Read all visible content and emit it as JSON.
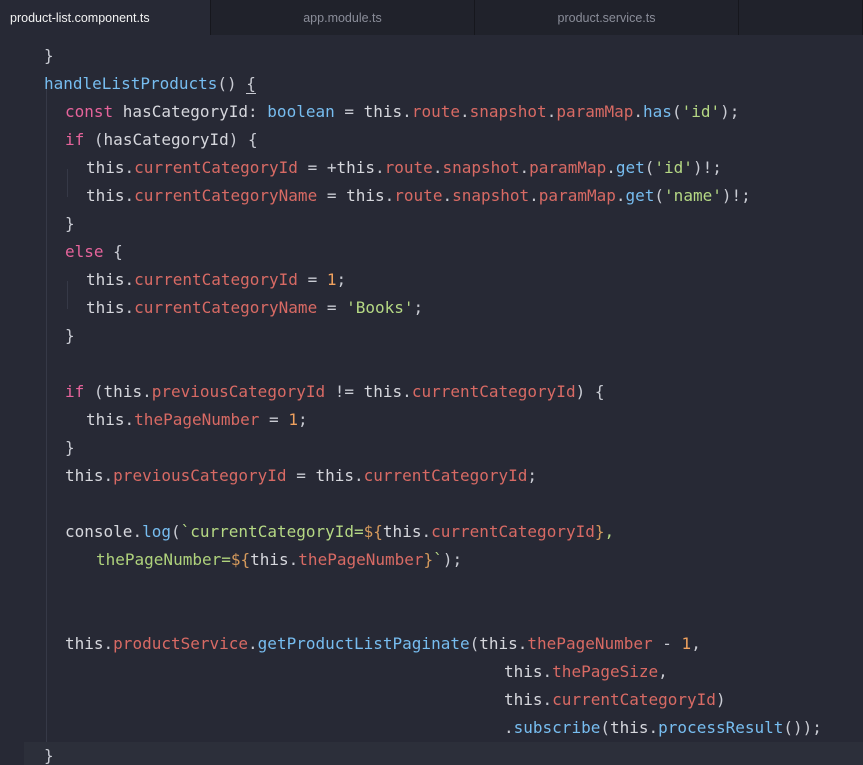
{
  "tabs": [
    {
      "label": "product-list.component.ts",
      "active": true
    },
    {
      "label": "app.module.ts",
      "active": false
    },
    {
      "label": "product.service.ts",
      "active": false
    }
  ],
  "code": {
    "lines": [
      {
        "indent": 44,
        "tokens": [
          {
            "c": "o",
            "v": "}"
          }
        ]
      },
      {
        "indent": 44,
        "tokens": [
          {
            "c": "f",
            "v": "handleListProducts"
          },
          {
            "c": "o",
            "v": "() "
          },
          {
            "c": "o ul",
            "v": "{"
          }
        ]
      },
      {
        "indent": 65,
        "tokens": [
          {
            "c": "k",
            "v": "const "
          },
          {
            "c": "t",
            "v": "hasCategoryId"
          },
          {
            "c": "o",
            "v": ": "
          },
          {
            "c": "f",
            "v": "boolean"
          },
          {
            "c": "o",
            "v": " = "
          },
          {
            "c": "t",
            "v": "this"
          },
          {
            "c": "o",
            "v": "."
          },
          {
            "c": "p",
            "v": "route"
          },
          {
            "c": "o",
            "v": "."
          },
          {
            "c": "p",
            "v": "snapshot"
          },
          {
            "c": "o",
            "v": "."
          },
          {
            "c": "p",
            "v": "paramMap"
          },
          {
            "c": "o",
            "v": "."
          },
          {
            "c": "f",
            "v": "has"
          },
          {
            "c": "o",
            "v": "("
          },
          {
            "c": "s",
            "v": "'id'"
          },
          {
            "c": "o",
            "v": ");"
          }
        ]
      },
      {
        "indent": 65,
        "tokens": [
          {
            "c": "k",
            "v": "if "
          },
          {
            "c": "o",
            "v": "("
          },
          {
            "c": "t",
            "v": "hasCategoryId"
          },
          {
            "c": "o",
            "v": ") {"
          }
        ]
      },
      {
        "indent": 86,
        "tokens": [
          {
            "c": "t",
            "v": "this"
          },
          {
            "c": "o",
            "v": "."
          },
          {
            "c": "p",
            "v": "currentCategoryId"
          },
          {
            "c": "o",
            "v": " = +"
          },
          {
            "c": "t",
            "v": "this"
          },
          {
            "c": "o",
            "v": "."
          },
          {
            "c": "p",
            "v": "route"
          },
          {
            "c": "o",
            "v": "."
          },
          {
            "c": "p",
            "v": "snapshot"
          },
          {
            "c": "o",
            "v": "."
          },
          {
            "c": "p",
            "v": "paramMap"
          },
          {
            "c": "o",
            "v": "."
          },
          {
            "c": "f",
            "v": "get"
          },
          {
            "c": "o",
            "v": "("
          },
          {
            "c": "s",
            "v": "'id'"
          },
          {
            "c": "o",
            "v": ")!;"
          }
        ]
      },
      {
        "indent": 86,
        "tokens": [
          {
            "c": "t",
            "v": "this"
          },
          {
            "c": "o",
            "v": "."
          },
          {
            "c": "p",
            "v": "currentCategoryName"
          },
          {
            "c": "o",
            "v": " = "
          },
          {
            "c": "t",
            "v": "this"
          },
          {
            "c": "o",
            "v": "."
          },
          {
            "c": "p",
            "v": "route"
          },
          {
            "c": "o",
            "v": "."
          },
          {
            "c": "p",
            "v": "snapshot"
          },
          {
            "c": "o",
            "v": "."
          },
          {
            "c": "p",
            "v": "paramMap"
          },
          {
            "c": "o",
            "v": "."
          },
          {
            "c": "f",
            "v": "get"
          },
          {
            "c": "o",
            "v": "("
          },
          {
            "c": "s",
            "v": "'name'"
          },
          {
            "c": "o",
            "v": ")!;"
          }
        ]
      },
      {
        "indent": 65,
        "tokens": [
          {
            "c": "o",
            "v": "}"
          }
        ]
      },
      {
        "indent": 65,
        "tokens": [
          {
            "c": "k",
            "v": "else "
          },
          {
            "c": "o",
            "v": "{"
          }
        ]
      },
      {
        "indent": 86,
        "tokens": [
          {
            "c": "t",
            "v": "this"
          },
          {
            "c": "o",
            "v": "."
          },
          {
            "c": "p",
            "v": "currentCategoryId"
          },
          {
            "c": "o",
            "v": " = "
          },
          {
            "c": "n",
            "v": "1"
          },
          {
            "c": "o",
            "v": ";"
          }
        ]
      },
      {
        "indent": 86,
        "tokens": [
          {
            "c": "t",
            "v": "this"
          },
          {
            "c": "o",
            "v": "."
          },
          {
            "c": "p",
            "v": "currentCategoryName"
          },
          {
            "c": "o",
            "v": " = "
          },
          {
            "c": "s",
            "v": "'Books'"
          },
          {
            "c": "o",
            "v": ";"
          }
        ]
      },
      {
        "indent": 65,
        "tokens": [
          {
            "c": "o",
            "v": "}"
          }
        ]
      },
      {
        "indent": 65,
        "tokens": []
      },
      {
        "indent": 65,
        "tokens": [
          {
            "c": "k",
            "v": "if "
          },
          {
            "c": "o",
            "v": "("
          },
          {
            "c": "t",
            "v": "this"
          },
          {
            "c": "o",
            "v": "."
          },
          {
            "c": "p",
            "v": "previousCategoryId"
          },
          {
            "c": "o",
            "v": " != "
          },
          {
            "c": "t",
            "v": "this"
          },
          {
            "c": "o",
            "v": "."
          },
          {
            "c": "p",
            "v": "currentCategoryId"
          },
          {
            "c": "o",
            "v": ") {"
          }
        ]
      },
      {
        "indent": 86,
        "tokens": [
          {
            "c": "t",
            "v": "this"
          },
          {
            "c": "o",
            "v": "."
          },
          {
            "c": "p",
            "v": "thePageNumber"
          },
          {
            "c": "o",
            "v": " = "
          },
          {
            "c": "n",
            "v": "1"
          },
          {
            "c": "o",
            "v": ";"
          }
        ]
      },
      {
        "indent": 65,
        "tokens": [
          {
            "c": "o",
            "v": "}"
          }
        ]
      },
      {
        "indent": 65,
        "tokens": [
          {
            "c": "t",
            "v": "this"
          },
          {
            "c": "o",
            "v": "."
          },
          {
            "c": "p",
            "v": "previousCategoryId"
          },
          {
            "c": "o",
            "v": " = "
          },
          {
            "c": "t",
            "v": "this"
          },
          {
            "c": "o",
            "v": "."
          },
          {
            "c": "p",
            "v": "currentCategoryId"
          },
          {
            "c": "o",
            "v": ";"
          }
        ]
      },
      {
        "indent": 65,
        "tokens": []
      },
      {
        "indent": 65,
        "tokens": [
          {
            "c": "t",
            "v": "console"
          },
          {
            "c": "o",
            "v": "."
          },
          {
            "c": "f",
            "v": "log"
          },
          {
            "c": "o",
            "v": "("
          },
          {
            "c": "s",
            "v": "`currentCategoryId="
          },
          {
            "c": "tp",
            "v": "${"
          },
          {
            "c": "t",
            "v": "this"
          },
          {
            "c": "o",
            "v": "."
          },
          {
            "c": "p",
            "v": "currentCategoryId"
          },
          {
            "c": "tp",
            "v": "}"
          },
          {
            "c": "s",
            "v": ","
          }
        ]
      },
      {
        "indent": 96,
        "tokens": [
          {
            "c": "g",
            "v": "thePageNumber="
          },
          {
            "c": "tp",
            "v": "${"
          },
          {
            "c": "t",
            "v": "this"
          },
          {
            "c": "o",
            "v": "."
          },
          {
            "c": "p",
            "v": "thePageNumber"
          },
          {
            "c": "tp",
            "v": "}"
          },
          {
            "c": "s",
            "v": "`"
          },
          {
            "c": "o",
            "v": ");"
          }
        ]
      },
      {
        "indent": 65,
        "tokens": []
      },
      {
        "indent": 65,
        "tokens": []
      },
      {
        "indent": 65,
        "tokens": [
          {
            "c": "t",
            "v": "this"
          },
          {
            "c": "o",
            "v": "."
          },
          {
            "c": "p",
            "v": "productService"
          },
          {
            "c": "o",
            "v": "."
          },
          {
            "c": "f",
            "v": "getProductListPaginate"
          },
          {
            "c": "o",
            "v": "("
          },
          {
            "c": "t",
            "v": "this"
          },
          {
            "c": "o",
            "v": "."
          },
          {
            "c": "p",
            "v": "thePageNumber"
          },
          {
            "c": "o",
            "v": " - "
          },
          {
            "c": "n",
            "v": "1"
          },
          {
            "c": "o",
            "v": ","
          }
        ]
      },
      {
        "indent": 504,
        "tokens": [
          {
            "c": "t",
            "v": "this"
          },
          {
            "c": "o",
            "v": "."
          },
          {
            "c": "p",
            "v": "thePageSize"
          },
          {
            "c": "o",
            "v": ","
          }
        ]
      },
      {
        "indent": 504,
        "tokens": [
          {
            "c": "t",
            "v": "this"
          },
          {
            "c": "o",
            "v": "."
          },
          {
            "c": "p",
            "v": "currentCategoryId"
          },
          {
            "c": "o",
            "v": ")"
          }
        ]
      },
      {
        "indent": 504,
        "tokens": [
          {
            "c": "o",
            "v": "."
          },
          {
            "c": "f",
            "v": "subscribe"
          },
          {
            "c": "o",
            "v": "("
          },
          {
            "c": "t",
            "v": "this"
          },
          {
            "c": "o",
            "v": "."
          },
          {
            "c": "f",
            "v": "processResult"
          },
          {
            "c": "o",
            "v": "());"
          }
        ]
      },
      {
        "indent": 44,
        "tokens": [
          {
            "c": "o",
            "v": "}"
          }
        ]
      }
    ]
  }
}
